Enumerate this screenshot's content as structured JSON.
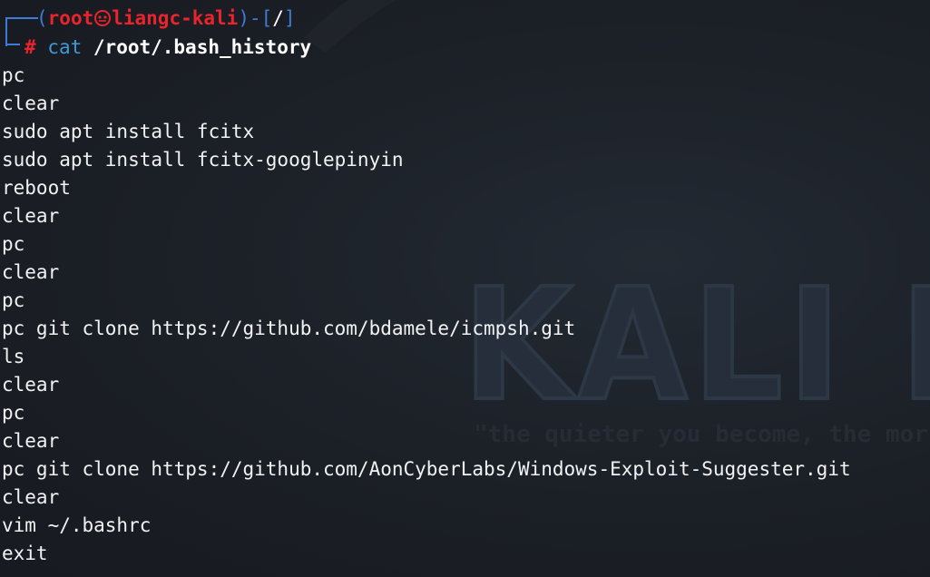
{
  "prompt": {
    "user": "root",
    "host": "liangc-kali",
    "cwd": "/",
    "symbol": "#",
    "command": "cat",
    "argument": "/root/.bash_history",
    "separator_icon": "skull-icon"
  },
  "history": [
    "pc",
    "clear",
    "sudo apt install fcitx",
    "sudo apt install fcitx-googlepinyin",
    "reboot",
    "clear",
    "pc",
    "clear",
    "pc",
    "pc git clone https://github.com/bdamele/icmpsh.git",
    "ls",
    "clear",
    "pc",
    "clear",
    "pc git clone https://github.com/AonCyberLabs/Windows-Exploit-Suggester.git",
    "clear",
    "vim ~/.bashrc",
    "exit"
  ],
  "watermark": {
    "logo": "KALI LI",
    "tagline": "\"the quieter you become, the mor"
  },
  "colors": {
    "background": "#1c2128",
    "prompt_blue": "#3e7bd6",
    "prompt_red": "#e8242d",
    "command_blue": "#3e9ad6",
    "text": "#f2f2f2"
  }
}
